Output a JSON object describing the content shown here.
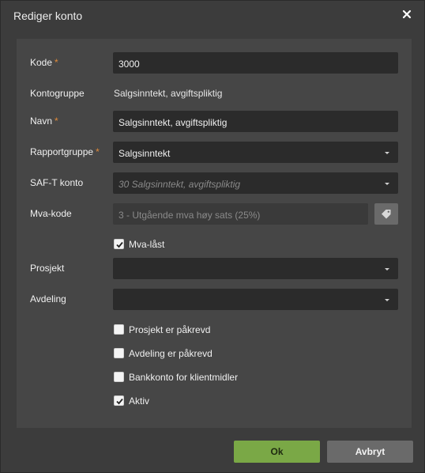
{
  "dialog": {
    "title": "Rediger konto",
    "required_marker": "*"
  },
  "form": {
    "kode": {
      "label": "Kode",
      "value": "3000"
    },
    "kontogruppe": {
      "label": "Kontogruppe",
      "value": "Salgsinntekt, avgiftspliktig"
    },
    "navn": {
      "label": "Navn",
      "value": "Salgsinntekt, avgiftspliktig"
    },
    "rapportgruppe": {
      "label": "Rapportgruppe",
      "value": "Salgsinntekt"
    },
    "saft_konto": {
      "label": "SAF-T konto",
      "value": "30 Salgsinntekt, avgiftspliktig"
    },
    "mva_kode": {
      "label": "Mva-kode",
      "value": "3 - Utgående mva høy sats (25%)"
    },
    "mva_last": {
      "label": "Mva-låst",
      "checked": true
    },
    "prosjekt": {
      "label": "Prosjekt",
      "value": ""
    },
    "avdeling": {
      "label": "Avdeling",
      "value": ""
    },
    "prosjekt_pakrevd": {
      "label": "Prosjekt er påkrevd",
      "checked": false
    },
    "avdeling_pakrevd": {
      "label": "Avdeling er påkrevd",
      "checked": false
    },
    "bankkonto_klientmidler": {
      "label": "Bankkonto for klientmidler",
      "checked": false
    },
    "aktiv": {
      "label": "Aktiv",
      "checked": true
    }
  },
  "buttons": {
    "ok": "Ok",
    "cancel": "Avbryt"
  },
  "colors": {
    "ok_button": "#7aa846",
    "required_marker": "#e08a3a"
  }
}
